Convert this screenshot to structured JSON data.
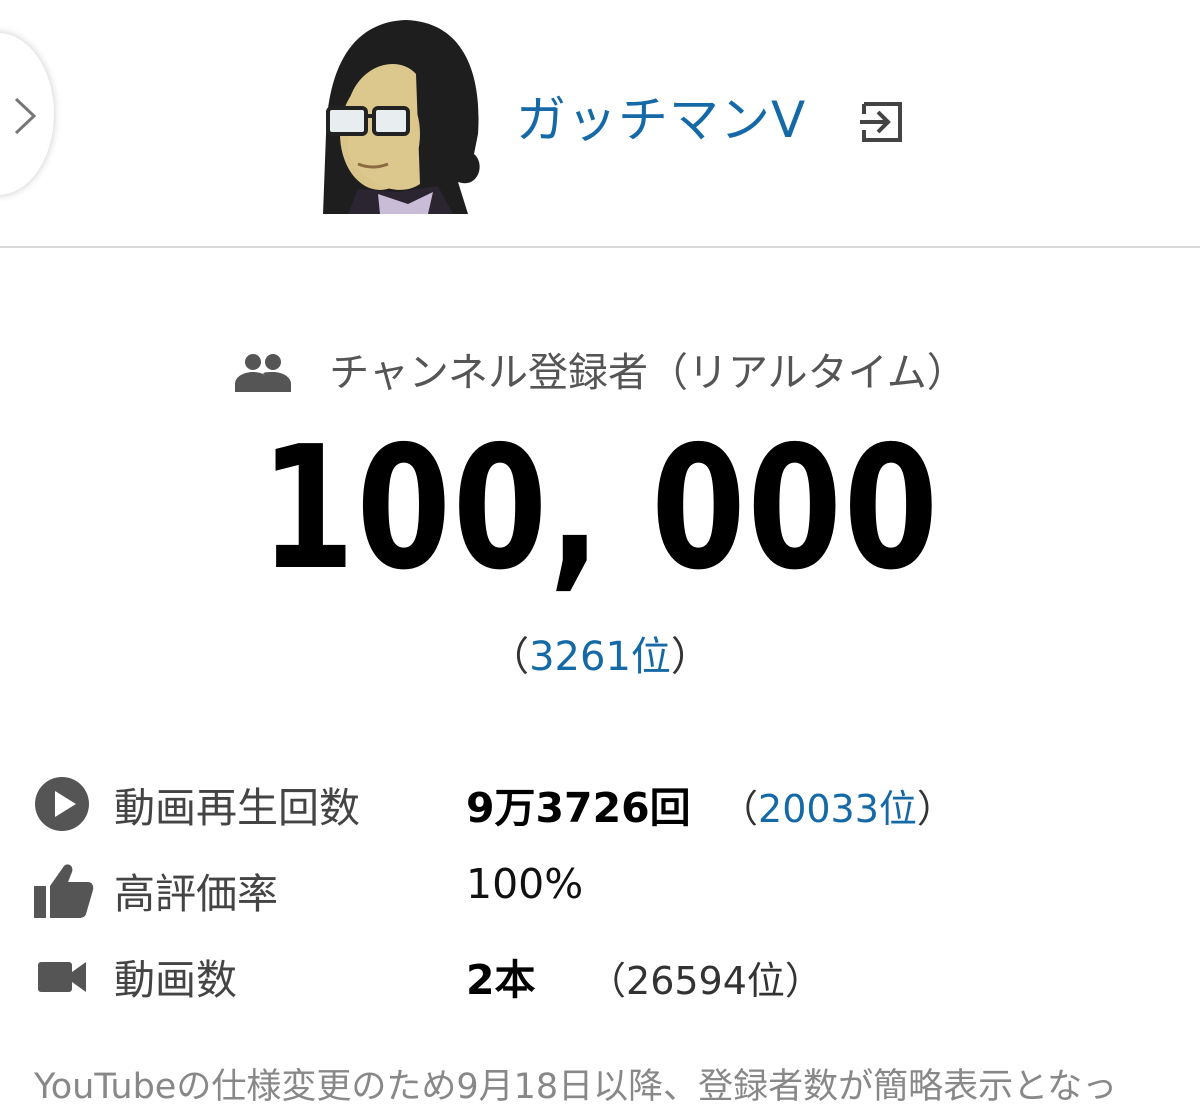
{
  "header": {
    "channel_name": "ガッチマンV"
  },
  "subscribers": {
    "label": "チャンネル登録者（リアルタイム）",
    "count": "100, 000",
    "rank_open": "（",
    "rank": "3261位",
    "rank_close": "）"
  },
  "stats": [
    {
      "label": "動画再生回数",
      "value": "9万3726回",
      "rank_open": "（",
      "rank": "20033位",
      "rank_close": "）",
      "icon": "play-circle-icon"
    },
    {
      "label": "高評価率",
      "value": "100%",
      "icon": "thumbs-up-icon"
    },
    {
      "label": "動画数",
      "value": "2本",
      "rank_open": "（",
      "rank": "26594位",
      "rank_close": "）",
      "icon": "video-camera-icon"
    }
  ],
  "notice": "YouTubeの仕様変更のため9月18日以降、登録者数が簡略表示となっ",
  "colors": {
    "link": "#1469a6",
    "icon": "#555555",
    "divider": "#d8d8d8"
  }
}
